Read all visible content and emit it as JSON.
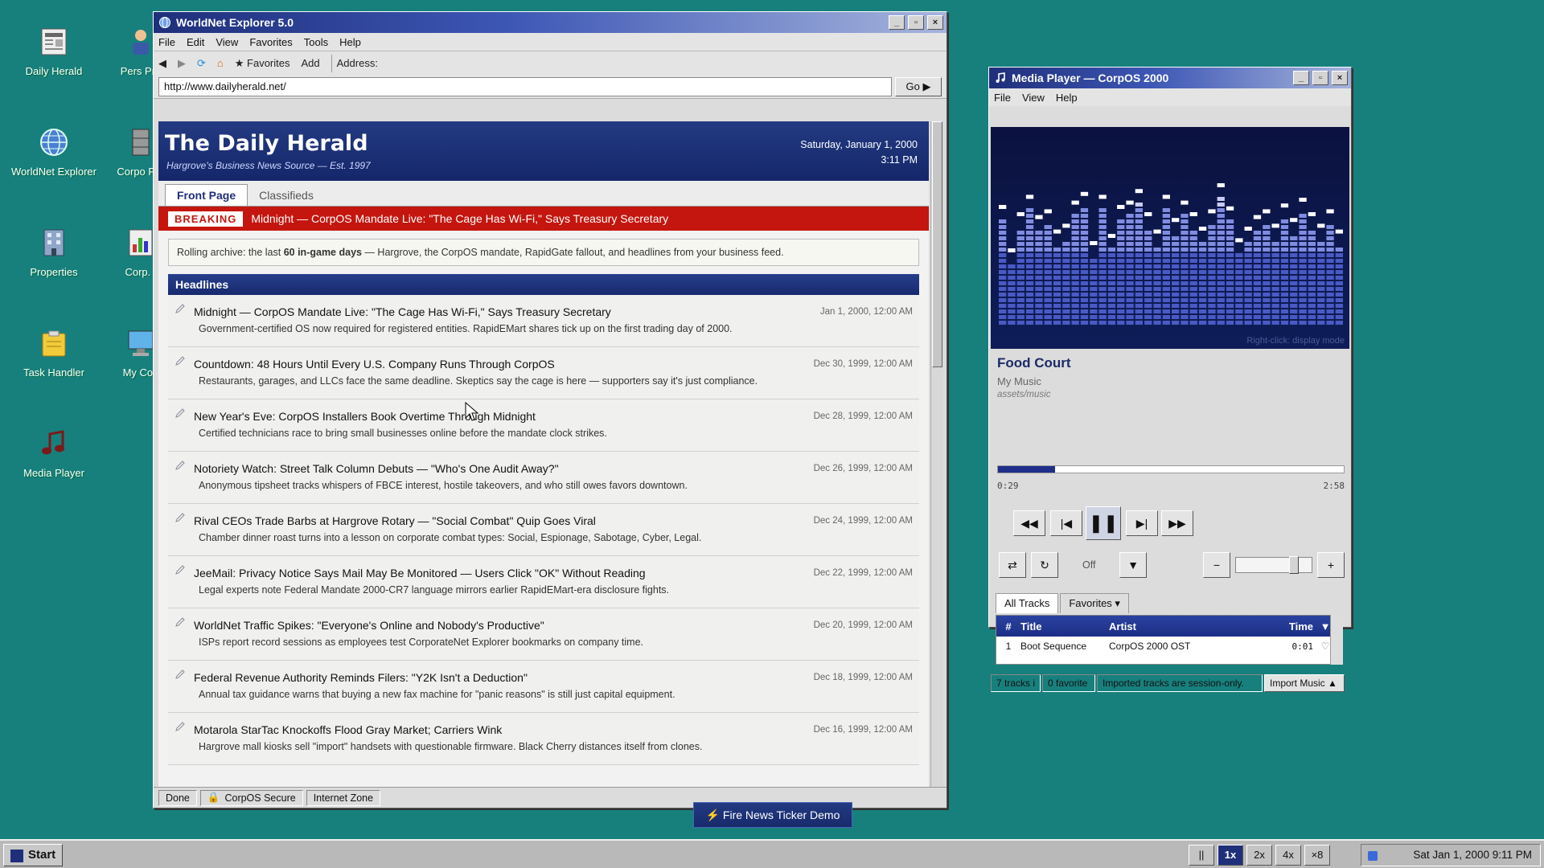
{
  "desktop": {
    "icons": [
      {
        "label": "Daily Herald",
        "icon": "newspaper-icon"
      },
      {
        "label": "WorldNet Explorer",
        "icon": "globe-icon"
      },
      {
        "label": "Properties",
        "icon": "building-icon"
      },
      {
        "label": "Task Handler",
        "icon": "folder-icon"
      },
      {
        "label": "Media Player",
        "icon": "music-note-icon"
      },
      {
        "label": "Pers Pro",
        "icon": "person-icon"
      },
      {
        "label": "Corpo Pro",
        "icon": "file-cabinet-icon"
      },
      {
        "label": "Corp. I",
        "icon": "chart-icon"
      },
      {
        "label": "My Con",
        "icon": "computer-icon"
      }
    ]
  },
  "browser": {
    "title": "WorldNet Explorer 5.0",
    "menu": [
      "File",
      "Edit",
      "View",
      "Favorites",
      "Tools",
      "Help"
    ],
    "toolbar": {
      "favorites": "★ Favorites",
      "add": "Add",
      "address_label": "Address:"
    },
    "url": "http://www.dailyherald.net/",
    "go": "Go ▶",
    "status": {
      "done": "Done",
      "secure": "CorpOS Secure",
      "zone": "Internet Zone"
    }
  },
  "herald": {
    "name": "The Daily Herald",
    "tagline": "Hargrove's Business News Source — Est. 1997",
    "date": "Saturday, January 1, 2000",
    "time": "3:11 PM",
    "tabs": [
      "Front Page",
      "Classifieds"
    ],
    "breaking_label": "BREAKING",
    "breaking_text": "Midnight — CorpOS Mandate Live: \"The Cage Has Wi-Fi,\" Says Treasury Secretary",
    "note_prefix": "Rolling archive: the last ",
    "note_bold": "60 in-game days",
    "note_suffix": " — Hargrove, the CorpOS mandate, RapidGate fallout, and headlines from your business feed.",
    "headlines_title": "Headlines",
    "headlines": [
      {
        "title": "Midnight — CorpOS Mandate Live: \"The Cage Has Wi-Fi,\" Says Treasury Secretary",
        "date": "Jan 1, 2000, 12:00 AM",
        "summary": "Government-certified OS now required for registered entities. RapidEMart shares tick up on the first trading day of 2000."
      },
      {
        "title": "Countdown: 48 Hours Until Every U.S. Company Runs Through CorpOS",
        "date": "Dec 30, 1999, 12:00 AM",
        "summary": "Restaurants, garages, and LLCs face the same deadline. Skeptics say the cage is here — supporters say it's just compliance."
      },
      {
        "title": "New Year's Eve: CorpOS Installers Book Overtime Through Midnight",
        "date": "Dec 28, 1999, 12:00 AM",
        "summary": "Certified technicians race to bring small businesses online before the mandate clock strikes."
      },
      {
        "title": "Notoriety Watch: Street Talk Column Debuts — \"Who's One Audit Away?\"",
        "date": "Dec 26, 1999, 12:00 AM",
        "summary": "Anonymous tipsheet tracks whispers of FBCE interest, hostile takeovers, and who still owes favors downtown."
      },
      {
        "title": "Rival CEOs Trade Barbs at Hargrove Rotary — \"Social Combat\" Quip Goes Viral",
        "date": "Dec 24, 1999, 12:00 AM",
        "summary": "Chamber dinner roast turns into a lesson on corporate combat types: Social, Espionage, Sabotage, Cyber, Legal."
      },
      {
        "title": "JeeMail: Privacy Notice Says Mail May Be Monitored — Users Click \"OK\" Without Reading",
        "date": "Dec 22, 1999, 12:00 AM",
        "summary": "Legal experts note Federal Mandate 2000-CR7 language mirrors earlier RapidEMart-era disclosure fights."
      },
      {
        "title": "WorldNet Traffic Spikes: \"Everyone's Online and Nobody's Productive\"",
        "date": "Dec 20, 1999, 12:00 AM",
        "summary": "ISPs report record sessions as employees test CorporateNet Explorer bookmarks on company time."
      },
      {
        "title": "Federal Revenue Authority Reminds Filers: \"Y2K Isn't a Deduction\"",
        "date": "Dec 18, 1999, 12:00 AM",
        "summary": "Annual tax guidance warns that buying a new fax machine for \"panic reasons\" is still just capital equipment."
      },
      {
        "title": "Motarola StarTac Knockoffs Flood Gray Market; Carriers Wink",
        "date": "Dec 16, 1999, 12:00 AM",
        "summary": "Hargrove mall kiosks sell \"import\" handsets with questionable firmware. Black Cherry distances itself from clones."
      }
    ]
  },
  "player": {
    "title": "Media Player — CorpOS 2000",
    "menu": [
      "File",
      "View",
      "Help"
    ],
    "viz_hint": "Right-click: display mode",
    "track_title": "Food Court",
    "artist": "My Music",
    "path": "assets/music",
    "elapsed": "0:29",
    "total": "2:58",
    "progress_fraction": 0.166,
    "volume_fraction": 0.78,
    "repeat_label": "Off",
    "tabs": [
      "All Tracks",
      "Favorites ▾"
    ],
    "columns": [
      "#",
      "Title",
      "Artist",
      "Time",
      "▼"
    ],
    "tracks": [
      {
        "num": "1",
        "title": "Boot Sequence",
        "artist": "CorpOS 2000 OST",
        "time": "0:01",
        "fav": "♡"
      }
    ],
    "status": {
      "count": "7 tracks i",
      "favorites": "0 favorite",
      "note": "Imported tracks are session-only.",
      "import": "Import Music ▲"
    },
    "viz_levels": [
      0.75,
      0.45,
      0.7,
      0.82,
      0.68,
      0.72,
      0.58,
      0.62,
      0.78,
      0.84,
      0.5,
      0.82,
      0.55,
      0.75,
      0.78,
      0.86,
      0.7,
      0.58,
      0.82,
      0.66,
      0.78,
      0.7,
      0.6,
      0.72,
      0.9,
      0.74,
      0.52,
      0.6,
      0.68,
      0.72,
      0.62,
      0.76,
      0.66,
      0.8,
      0.7,
      0.62,
      0.72,
      0.58
    ]
  },
  "taskbar": {
    "start": "Start",
    "ticker": "⚡ Fire News Ticker Demo",
    "speeds": [
      "||",
      "1x",
      "2x",
      "4x",
      "×8"
    ],
    "active_speed": "1x",
    "clock": "Sat Jan 1, 2000 9:11 PM"
  },
  "colors": {
    "desktop": "#17807d",
    "title_blue": "#1f2f7a",
    "breaking_red": "#c4160e"
  }
}
